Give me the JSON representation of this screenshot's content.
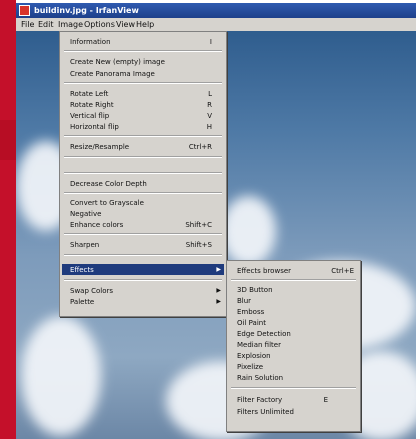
{
  "window": {
    "title": "buildinv.jpg - IrfanView"
  },
  "menubar": [
    "File",
    "Edit",
    "Image",
    "Options",
    "View",
    "Help"
  ],
  "image_menu": {
    "items": [
      {
        "label": "Information",
        "shortcut": "I"
      },
      {
        "label": "Create New (empty) image",
        "shortcut": ""
      },
      {
        "label": "Create Panorama Image",
        "shortcut": ""
      },
      {
        "label": "Rotate Left",
        "shortcut": "L"
      },
      {
        "label": "Rotate Right",
        "shortcut": "R"
      },
      {
        "label": "Vertical flip",
        "shortcut": "V"
      },
      {
        "label": "Horizontal flip",
        "shortcut": "H"
      },
      {
        "label": "Resize/Resample",
        "shortcut": "Ctrl+R"
      },
      {
        "label": "Decrease Color Depth",
        "shortcut": ""
      },
      {
        "label": "Convert to Grayscale",
        "shortcut": ""
      },
      {
        "label": "Negative",
        "shortcut": ""
      },
      {
        "label": "Enhance colors",
        "shortcut": "Shift+C"
      },
      {
        "label": "Sharpen",
        "shortcut": "Shift+S"
      },
      {
        "label": "Effects",
        "shortcut": ""
      },
      {
        "label": "Swap Colors",
        "shortcut": ""
      },
      {
        "label": "Palette",
        "shortcut": ""
      }
    ]
  },
  "effects_menu": {
    "items": [
      {
        "label": "Effects browser",
        "shortcut": "Ctrl+E"
      },
      {
        "label": "3D Button",
        "shortcut": ""
      },
      {
        "label": "Blur",
        "shortcut": ""
      },
      {
        "label": "Emboss",
        "shortcut": ""
      },
      {
        "label": "Oil Paint",
        "shortcut": ""
      },
      {
        "label": "Edge Detection",
        "shortcut": ""
      },
      {
        "label": "Median filter",
        "shortcut": ""
      },
      {
        "label": "Explosion",
        "shortcut": ""
      },
      {
        "label": "Pixelize",
        "shortcut": ""
      },
      {
        "label": "Rain Solution",
        "shortcut": ""
      },
      {
        "label": "Filter Factory",
        "shortcut": "E"
      },
      {
        "label": "Filters Unlimited",
        "shortcut": ""
      }
    ]
  },
  "colors": {
    "accent_red": "#c4102a",
    "menu_bg": "#d6d3ce",
    "highlight": "#1f3b7d",
    "titlebar": "#1d3f8a"
  }
}
